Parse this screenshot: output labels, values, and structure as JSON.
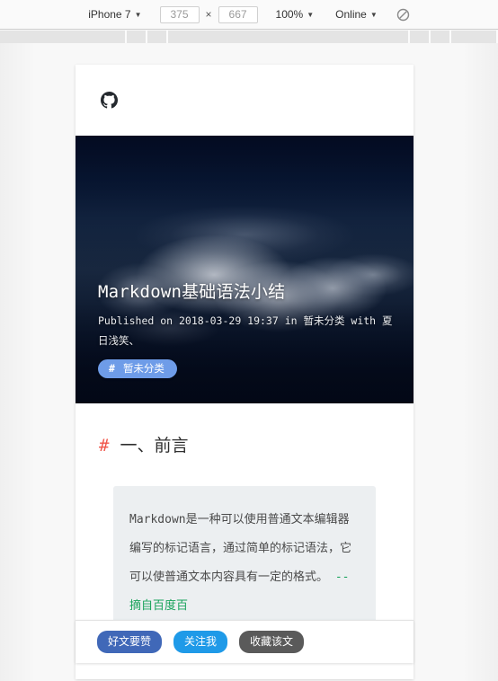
{
  "devtools": {
    "device_select": {
      "label": "iPhone 7",
      "icon": "chevron-down-icon"
    },
    "width_input": {
      "value": "375",
      "placeholder": "375"
    },
    "dimension_separator": "×",
    "height_input": {
      "value": "667",
      "placeholder": "667"
    },
    "zoom_select": {
      "label": "100%",
      "icon": "chevron-down-icon"
    },
    "throttle_select": {
      "label": "Online",
      "icon": "chevron-down-icon"
    },
    "rotate_button": {
      "icon": "rotate-device-icon",
      "title": "Rotate"
    }
  },
  "site": {
    "logo": {
      "icon": "octocat-icon"
    }
  },
  "post": {
    "title": "Markdown基础语法小结",
    "meta": "Published on 2018-03-29 19:37 in 暂未分类 with 夏日浅笑、",
    "tag": {
      "hash": "#",
      "label": "暂未分类"
    },
    "heading": {
      "anchor": "#",
      "text": "一、前言"
    },
    "quote": {
      "text": "Markdown是一种可以使用普通文本编辑器编写的标记语言，通过简单的标记语法，它可以使普通文本内容具有一定的格式。",
      "citation": "--摘自百度百"
    }
  },
  "actions": {
    "like": "好文要赞",
    "follow": "关注我",
    "favorite": "收藏该文"
  },
  "colors": {
    "tag_badge": "#6e9ce8",
    "anchor_hash": "#f0564a",
    "citation_green": "#19a35b",
    "btn_like": "#4068b8",
    "btn_follow": "#1f9ae8",
    "btn_favorite": "#5a5a5a",
    "hero_sky": "#040c26"
  }
}
